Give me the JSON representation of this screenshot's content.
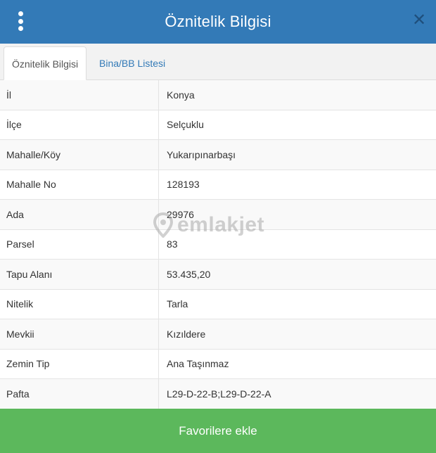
{
  "header": {
    "title": "Öznitelik Bilgisi",
    "menu_icon": "vertical-dots-icon",
    "close_icon": "close-icon"
  },
  "tabs": [
    {
      "label": "Öznitelik Bilgisi",
      "active": true
    },
    {
      "label": "Bina/BB Listesi",
      "active": false
    }
  ],
  "rows": [
    {
      "label": "İl",
      "value": "Konya"
    },
    {
      "label": "İlçe",
      "value": "Selçuklu"
    },
    {
      "label": "Mahalle/Köy",
      "value": "Yukarıpınarbaşı"
    },
    {
      "label": "Mahalle No",
      "value": "128193"
    },
    {
      "label": "Ada",
      "value": "29976"
    },
    {
      "label": "Parsel",
      "value": "83"
    },
    {
      "label": "Tapu Alanı",
      "value": "53.435,20"
    },
    {
      "label": "Nitelik",
      "value": "Tarla"
    },
    {
      "label": "Mevkii",
      "value": "Kızıldere"
    },
    {
      "label": "Zemin Tip",
      "value": "Ana Taşınmaz"
    },
    {
      "label": "Pafta",
      "value": "L29-D-22-B;L29-D-22-A"
    }
  ],
  "watermark": {
    "text": "emlakjet",
    "icon": "location-pin-icon"
  },
  "footer": {
    "button_label": "Favorilere ekle"
  },
  "colors": {
    "header_bg": "#337ab7",
    "footer_bg": "#5cb85c",
    "tab_link": "#337ab7"
  }
}
